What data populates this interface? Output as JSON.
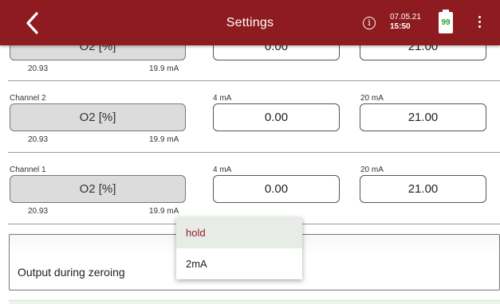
{
  "header": {
    "title": "Settings",
    "date": "07.05.21",
    "time": "15:50",
    "battery": 99,
    "battery_label": "99",
    "info_glyph": "i",
    "colors": {
      "bar": "#8e1b1f",
      "battery_text": "#26a32b"
    }
  },
  "rows": [
    {
      "channel": "",
      "unit": "O2 [%]",
      "value_left": "20.93",
      "value_right": "19.9  mA",
      "label_4ma": "",
      "label_20ma": "",
      "val_4ma": "0.00",
      "val_20ma": "21.00"
    },
    {
      "channel": "Channel 2",
      "unit": "O2 [%]",
      "value_left": "20.93",
      "value_right": "19.9  mA",
      "label_4ma": "4 mA",
      "label_20ma": "20 mA",
      "val_4ma": "0.00",
      "val_20ma": "21.00"
    },
    {
      "channel": "Channel 1",
      "unit": "O2 [%]",
      "value_left": "20.93",
      "value_right": "19.9  mA",
      "label_4ma": "4 mA",
      "label_20ma": "20 mA",
      "val_4ma": "0.00",
      "val_20ma": "21.00"
    }
  ],
  "zeroing": {
    "label": "Output during zeroing"
  },
  "dropdown": {
    "options": [
      {
        "label": "hold",
        "selected": true
      },
      {
        "label": "2mA",
        "selected": false
      }
    ]
  }
}
